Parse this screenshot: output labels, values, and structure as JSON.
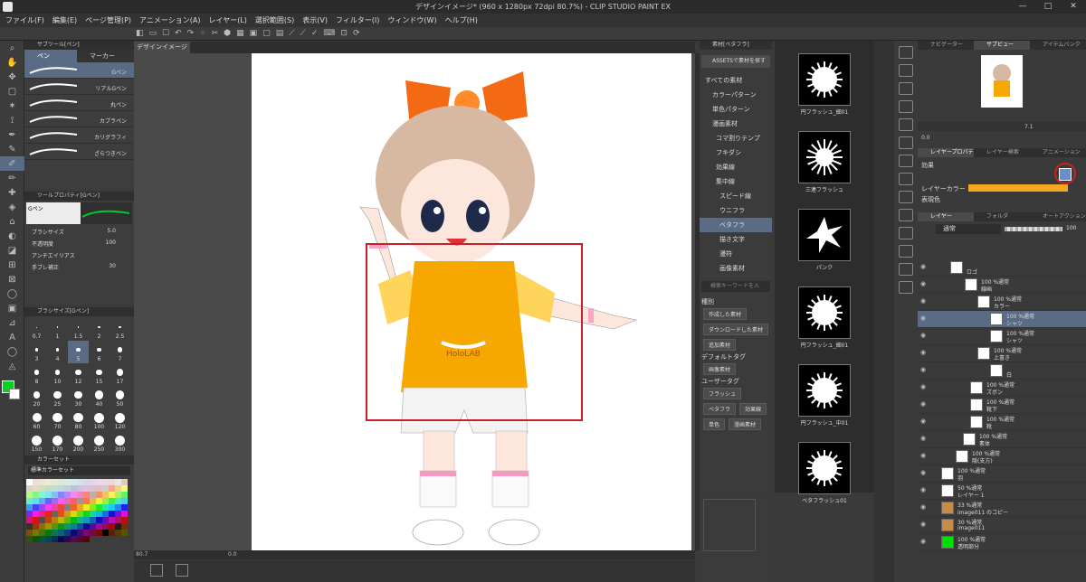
{
  "window": {
    "title": "デザインイメージ* (960 x 1280px 72dpi 80.7%)  - CLIP STUDIO PAINT EX",
    "minimize": "—",
    "maximize": "□",
    "close": "✕"
  },
  "menu": [
    "ファイル(F)",
    "編集(E)",
    "ページ管理(P)",
    "アニメーション(A)",
    "レイヤー(L)",
    "選択範囲(S)",
    "表示(V)",
    "フィルター(I)",
    "ウィンドウ(W)",
    "ヘルプ(H)"
  ],
  "canvas_tab": {
    "label": "デザインイメージ*",
    "close": "✕"
  },
  "subtool": {
    "header": "サブツール[ペン]",
    "tabs": [
      "ペン",
      "マーカー"
    ],
    "brushes": [
      "Gペン",
      "リアルGペン",
      "丸ペン",
      "カブラペン",
      "カリグラフィ",
      "ざらつきペン"
    ]
  },
  "tool_property": {
    "header": "ツールプロパティ[Gペン]",
    "current": "Gペン",
    "rows": [
      {
        "label": "ブラシサイズ",
        "value": "5.0"
      },
      {
        "label": "不透明度",
        "value": "100"
      },
      {
        "label": "アンチエイリアス",
        "value": ""
      },
      {
        "label": "手ブレ補正",
        "value": "30"
      }
    ]
  },
  "brush_size": {
    "header": "ブラシサイズ[Gペン]",
    "sizes": [
      "0.7",
      "1",
      "1.5",
      "2",
      "2.5",
      "3",
      "4",
      "5",
      "6",
      "7",
      "8",
      "10",
      "12",
      "15",
      "17",
      "20",
      "25",
      "30",
      "40",
      "50",
      "60",
      "70",
      "80",
      "100",
      "120",
      "150",
      "170",
      "200",
      "250",
      "300"
    ]
  },
  "color_set": {
    "header": "カラーセット",
    "selector": "標準カラーセット"
  },
  "statusbar": {
    "zoom": "80.7",
    "angle": "0.0"
  },
  "materials": {
    "header": "素材[ベタフラ]",
    "assets_button": "ASSETSで素材を探す",
    "tree": [
      "すべての素材",
      "カラーパターン",
      "単色パターン",
      "漫画素材",
      "コマ割りテンプ",
      "フキダシ",
      "効果線",
      "集中線",
      "スピード線",
      "ウニフラ",
      "ベタフラ",
      "描き文字",
      "漫符",
      "画像素材"
    ],
    "search_placeholder": "検索キーワードを入",
    "tag_section": "種別",
    "tags": [
      "作成した素材",
      "ダウンロードした素材",
      "追加素材"
    ],
    "default_tag": "デフォルトタグ",
    "default_tags": [
      "画像素材"
    ],
    "user_tag": "ユーザータグ",
    "user_tags": [
      "フラッシュ",
      "ベタフラ",
      "効果線",
      "単色",
      "漫画素材"
    ]
  },
  "material_thumbs": [
    "円フラッシュ_細01",
    "三連フラッシュ",
    "パンク",
    "円フラッシュ_細01",
    "円フラッシュ_中01",
    "ベタフラッシュ01"
  ],
  "navigator": {
    "tabs": [
      "ナビゲーター",
      "サブビュー",
      "アイテムバンク"
    ],
    "zoom": "7.1",
    "angle": "0.0"
  },
  "layer_property": {
    "tabs": [
      "レイヤープロパティ",
      "レイヤー検索",
      "アニメーション"
    ],
    "effect_label": "効果",
    "layer_color_label": "レイヤーカラー",
    "expression_label": "表現色",
    "layer_color": "#f5a623"
  },
  "layers": {
    "tabs": [
      "レイヤー",
      "フォルダ",
      "オートアクション"
    ],
    "blend": "通常",
    "opacity": "100",
    "items": [
      {
        "pct": "",
        "name": "ロゴ",
        "indent": 36
      },
      {
        "pct": "100 %通常",
        "name": "線画",
        "indent": 52
      },
      {
        "pct": "100 %通常",
        "name": "カラー",
        "indent": 66
      },
      {
        "pct": "100 %通常",
        "name": "シャツ",
        "indent": 80
      },
      {
        "pct": "100 %通常",
        "name": "シャツ",
        "indent": 80
      },
      {
        "pct": "100 %通常",
        "name": "上書き",
        "indent": 66
      },
      {
        "pct": "",
        "name": "白",
        "indent": 80
      },
      {
        "pct": "100 %通常",
        "name": "ズボン",
        "indent": 58
      },
      {
        "pct": "100 %通常",
        "name": "靴下",
        "indent": 58
      },
      {
        "pct": "100 %通常",
        "name": "靴",
        "indent": 58
      },
      {
        "pct": "100 %通常",
        "name": "素体",
        "indent": 50
      },
      {
        "pct": "100 %通常",
        "name": "隠(支方)",
        "indent": 42
      },
      {
        "pct": "100 %通常",
        "name": "羽",
        "indent": 26
      },
      {
        "pct": "50 %通常",
        "name": "レイヤー 1",
        "indent": 26
      },
      {
        "pct": "33 %通常",
        "name": "image011 のコピー",
        "indent": 26
      },
      {
        "pct": "30 %通常",
        "name": "image011",
        "indent": 26
      },
      {
        "pct": "100 %通常",
        "name": "透明部分",
        "indent": 26
      }
    ]
  },
  "artwork": {
    "shirt_text": "HoloLAB",
    "highlight_color": "#c8202a",
    "shirt_color": "#f7a800"
  }
}
